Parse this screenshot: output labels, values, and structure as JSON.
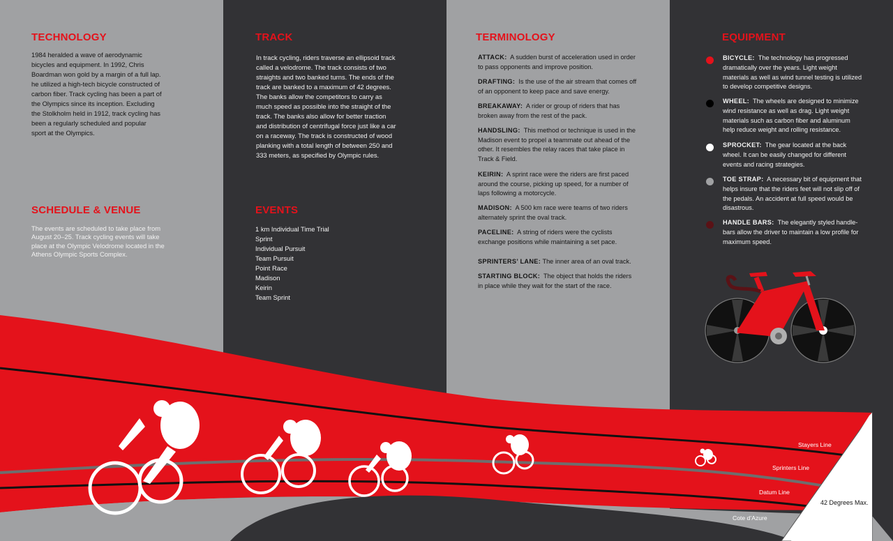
{
  "technology": {
    "heading": "TECHNOLOGY",
    "body": "1984 heralded a wave of aerodynamic bicycles and equipment. In 1992, Chris Boardman won gold by a margin of a full lap. he utilized a high-tech bicycle constructed of carbon fiber. Track cycling has been a part of the Olympics since its inception. Excluding the Stolkholm held in 1912, track cycling has been a regularly scheduled and popular sport at the Olympics."
  },
  "schedule": {
    "heading": "SCHEDULE & VENUE",
    "body": "The events are scheduled to take place from August 20–25. Track cycling events will take place at the Olympic Velodrome located in the Athens Olympic Sports Complex."
  },
  "track": {
    "heading": "TRACK",
    "body": "In track cycling, riders traverse an ellipsoid track called a velodrome. The track consists of two straights and two banked turns. The ends of the track are banked to a maximum of 42 degrees. The banks allow the competitors to carry as much speed as possible into the straight of the track. The banks also allow for better traction and distribution of centrifugal force just like a car on a raceway. The track is constructed of wood planking with a total length of between 250 and 333 meters, as specified by Olympic rules."
  },
  "events": {
    "heading": "EVENTS",
    "items": [
      "1 km Individual Time Trial",
      "Sprint",
      "Individual Pursuit",
      "Team Pursuit",
      "Point Race",
      "Madison",
      "Keirin",
      "Team Sprint"
    ]
  },
  "terminology": {
    "heading": "TERMINOLOGY",
    "terms": [
      {
        "term": "ATTACK:",
        "def": "A sudden burst of acceleration used in order to pass opponents and improve position."
      },
      {
        "term": "DRAFTING:",
        "def": "Is the use of the air stream that comes off of an opponent to keep pace and save energy."
      },
      {
        "term": "BREAKAWAY:",
        "def": "A rider or group of riders that has broken away from the rest of the pack."
      },
      {
        "term": "HANDSLING:",
        "def": "This method or technique is used in the Madison event to propel a teammate out ahead of the other. It resembles the relay races that take place in Track & Field."
      },
      {
        "term": "KEIRIN:",
        "def": "A sprint race were the riders are first paced around the course, picking up speed, for a number of laps following a motorcycle."
      },
      {
        "term": "MADISON:",
        "def": "A 500 km race were teams of two riders alternately sprint the oval track."
      },
      {
        "term": "PACELINE:",
        "def": "A string of riders were the cyclists exchange positions while maintaining a set pace."
      },
      {
        "term": "SPRINTERS’ LANE:",
        "def": "The inner area of an oval track."
      },
      {
        "term": "STARTING BLOCK:",
        "def": "The object that holds the riders in place while they wait for the start of the race."
      }
    ]
  },
  "equipment": {
    "heading": "EQUIPMENT",
    "items": [
      {
        "term": "BICYCLE:",
        "def": "The technology has progressed dramatically over the years. Light weight materials as well as wind tunnel testing is utilized to develop competitive designs.",
        "color": "#e4121b"
      },
      {
        "term": "WHEEL:",
        "def": "The wheels are designed to minimize wind resistance as well as drag. Light weight materials such as carbon fiber and aluminum help reduce weight and rolling resistance.",
        "color": "#000000"
      },
      {
        "term": "SPROCKET:",
        "def": "The gear located at the back wheel. It can be easily changed for different events and racing strategies.",
        "color": "#ffffff"
      },
      {
        "term": "TOE STRAP:",
        "def": "A necessary bit of equipment that helps insure that the riders feet will not slip off of the pedals. An accident at full speed would be disastrous.",
        "color": "#a0a1a3"
      },
      {
        "term": "HANDLE BARS:",
        "def": "The elegantly styled handle-bars allow the driver to maintain a low profile for maximum speed.",
        "color": "#5a1216"
      }
    ]
  },
  "lanes": {
    "stayers": "Stayers Line",
    "sprinters": "Sprinters Line",
    "datum": "Datum Line",
    "cote": "Cote d’Azure",
    "degrees": "42 Degrees Max."
  },
  "colors": {
    "accent": "#e4121b",
    "dark_panel": "#323235",
    "light_panel": "#a0a1a3"
  }
}
